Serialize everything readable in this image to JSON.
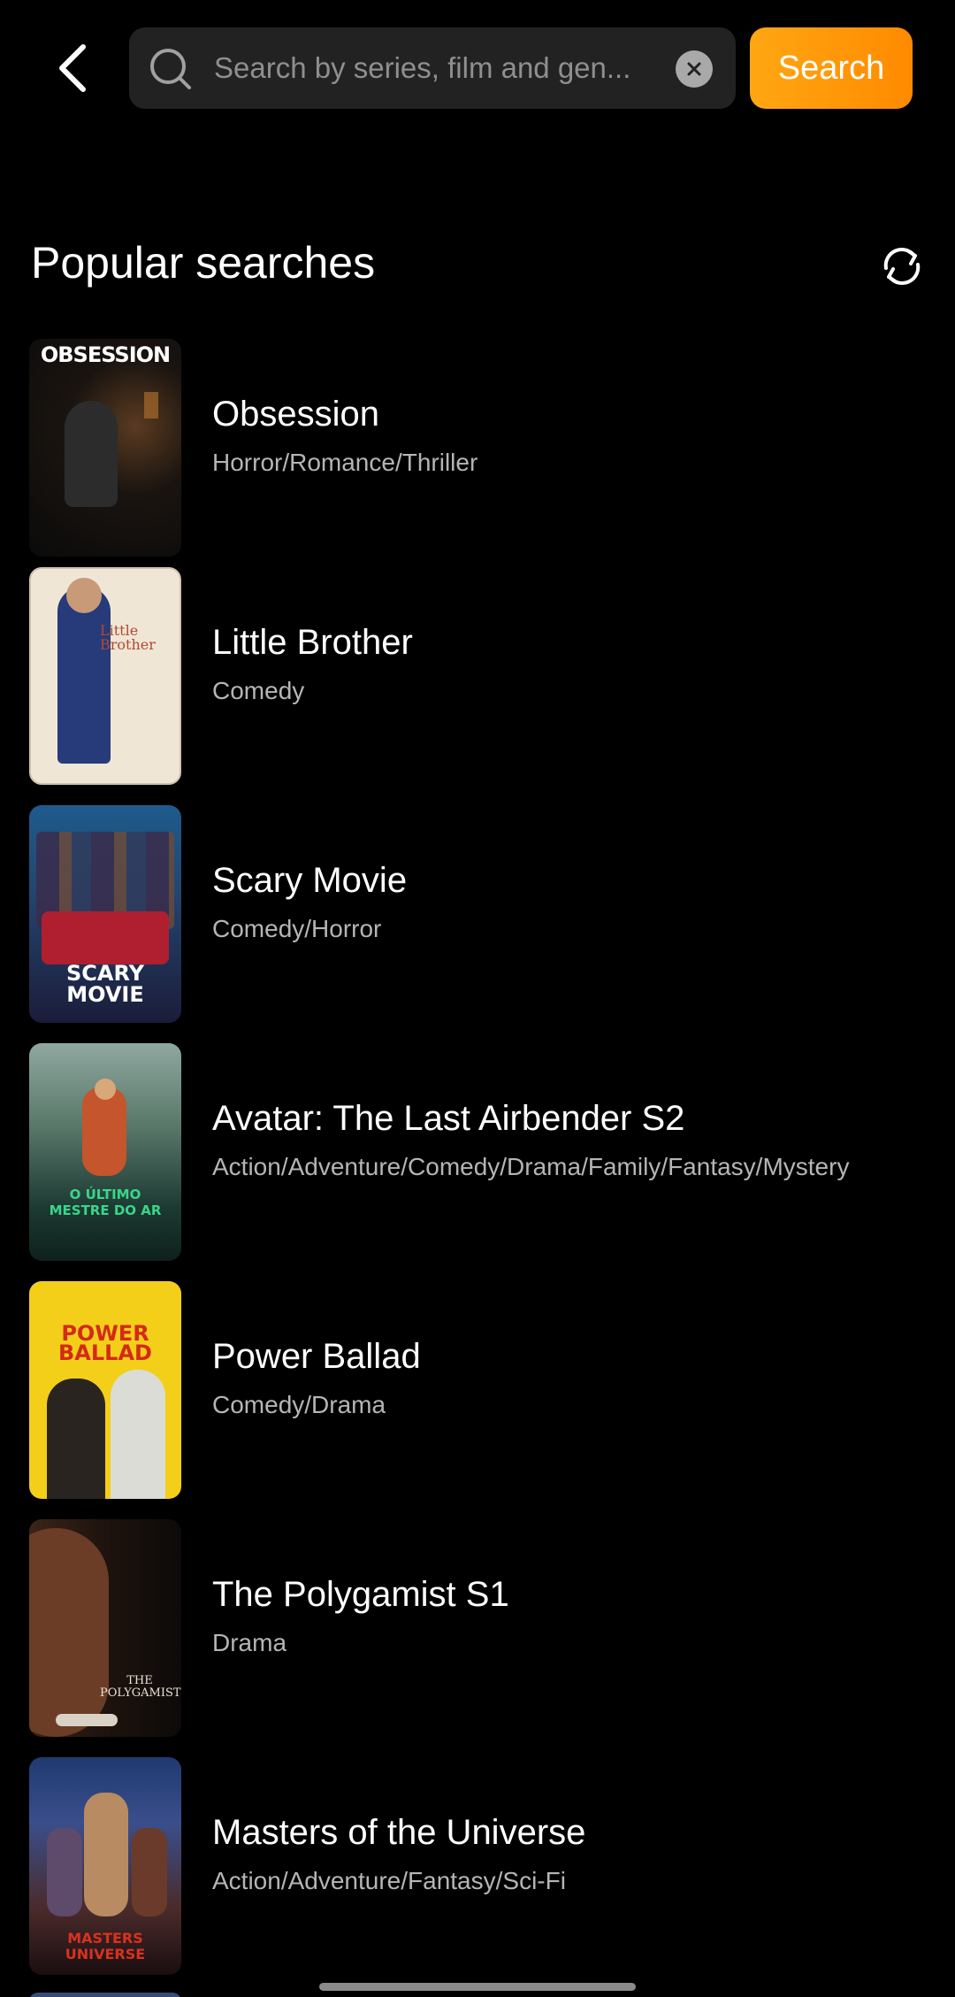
{
  "topbar": {
    "back_icon": "chevron-left-icon",
    "search_icon": "search-icon",
    "search_placeholder": "Search by series, film and gen...",
    "clear_icon": "clear-icon",
    "search_button_label": "Search",
    "accent_color": "#ff9a05"
  },
  "popular": {
    "title": "Popular searches",
    "refresh_icon": "refresh-icon",
    "items": [
      {
        "title": "Obsession",
        "genres": "Horror/Romance/Thriller",
        "poster_text": "OBSESSION"
      },
      {
        "title": "Little Brother",
        "genres": "Comedy",
        "poster_text": "Little Brother"
      },
      {
        "title": "Scary Movie",
        "genres": "Comedy/Horror",
        "poster_text": "SCARY MOVIE"
      },
      {
        "title": "Avatar: The Last Airbender S2",
        "genres": "Action/Adventure/Comedy/Drama/Family/Fantasy/Mystery",
        "poster_text": "O ÚLTIMO MESTRE DO AR"
      },
      {
        "title": "Power Ballad",
        "genres": "Comedy/Drama",
        "poster_text": "POWER BALLAD"
      },
      {
        "title": "The Polygamist S1",
        "genres": "Drama",
        "poster_text": "THE POLYGAMIST"
      },
      {
        "title": "Masters of the Universe",
        "genres": "Action/Adventure/Fantasy/Sci-Fi",
        "poster_text": "MASTERS UNIVERSE"
      }
    ]
  }
}
